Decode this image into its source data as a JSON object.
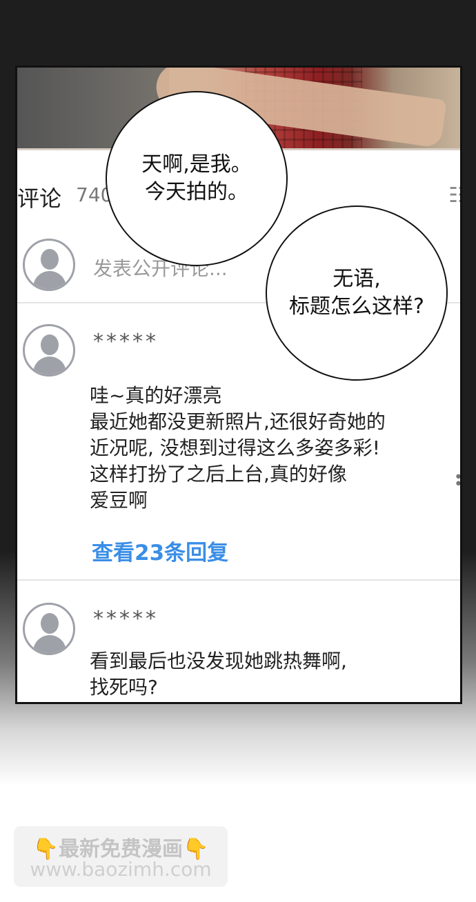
{
  "comments_header": {
    "title": "评论",
    "count": "740",
    "sort_glyph": "☷"
  },
  "post_input": {
    "placeholder": "发表公开评论..."
  },
  "comments": [
    {
      "user": "*****",
      "text": "哇~真的好漂亮\n最近她都没更新照片,还很好奇她的\n近况呢, 没想到过得这么多姿多彩!\n这样打扮了之后上台,真的好像\n爱豆啊",
      "replies_link": "查看23条回复"
    },
    {
      "user": "*****",
      "text": "看到最后也没发现她跳热舞啊,\n找死吗?"
    }
  ],
  "bubbles": [
    {
      "text": "天啊,是我。\n今天拍的。"
    },
    {
      "text": "无语,\n标题怎么这样?"
    }
  ],
  "watermark": {
    "line1": "最新免费漫画",
    "line2": "www.baozimh.com",
    "hand_glyph": "👇"
  },
  "icons": [
    "avatar-icon",
    "sort-icon",
    "more-icon",
    "pointing-down-icon"
  ],
  "colors": {
    "link": "#3a8ee6",
    "avatar": "#9ea1a8"
  }
}
